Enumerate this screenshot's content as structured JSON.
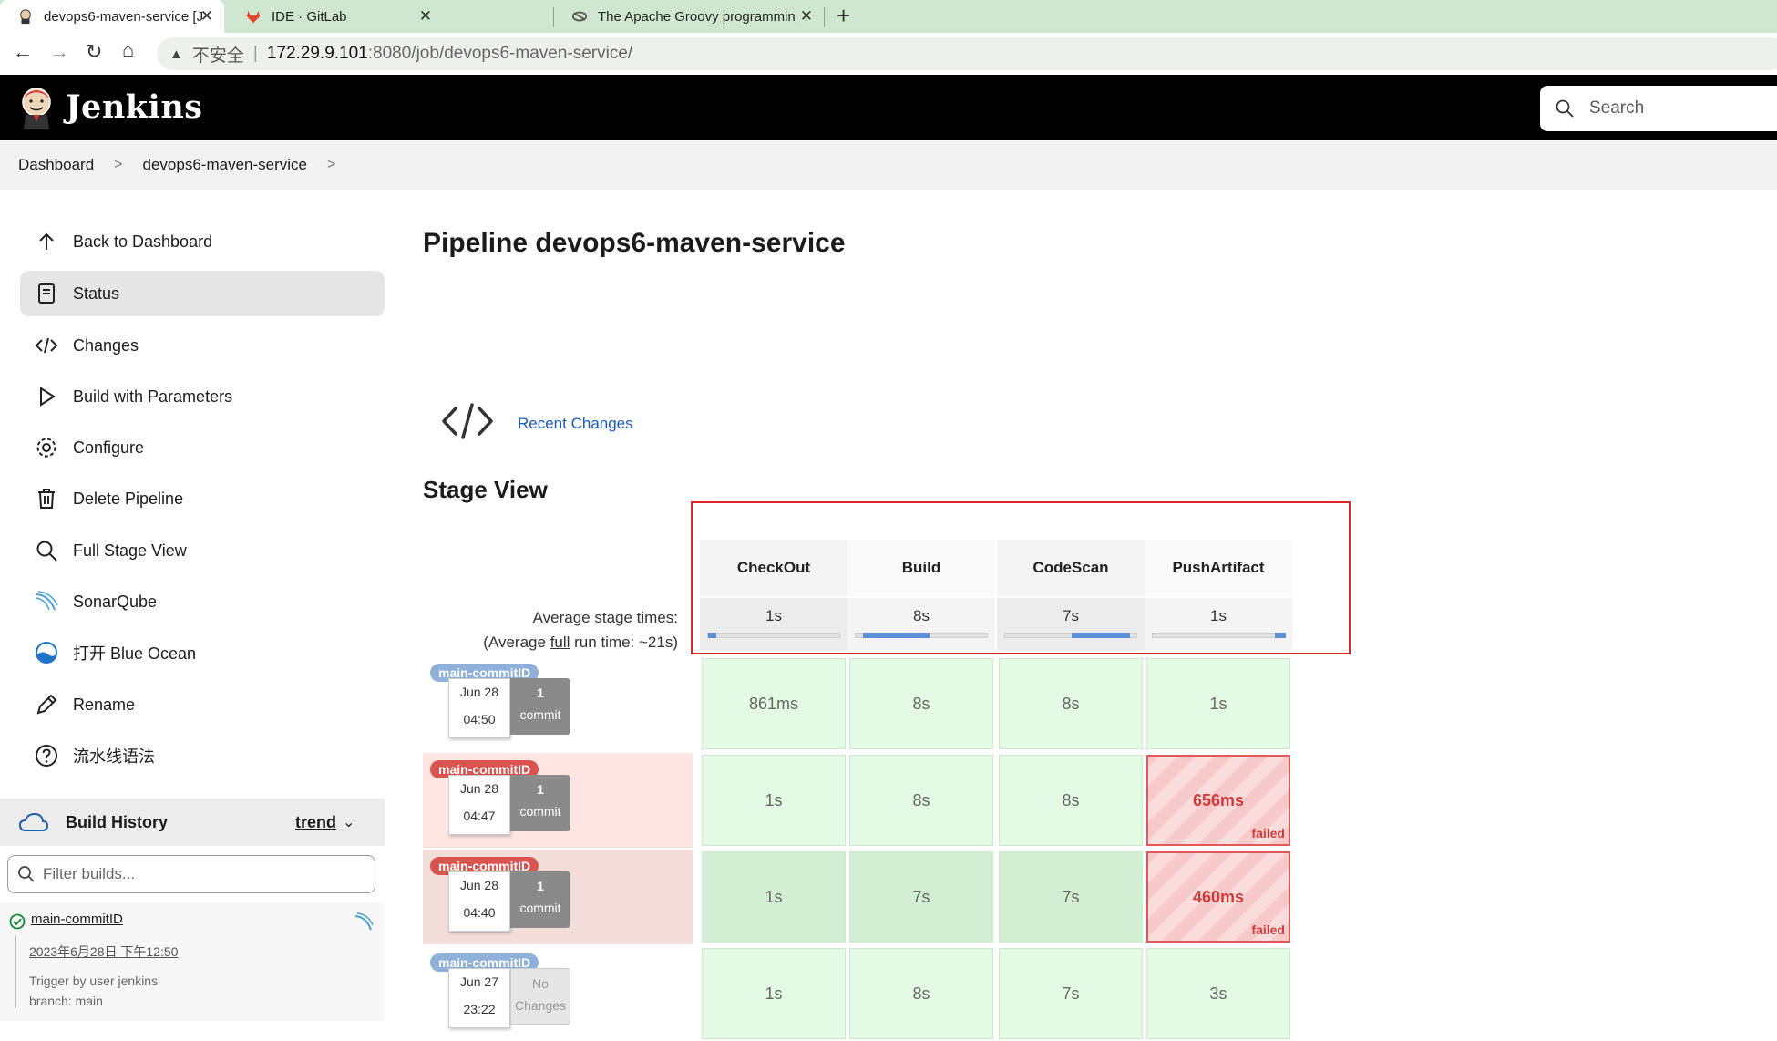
{
  "browser": {
    "tabs": [
      {
        "title": "devops6-maven-service [Jenkins]",
        "active": true,
        "icon": "jenkins-favicon"
      },
      {
        "title": "IDE · GitLab",
        "active": false,
        "icon": "gitlab-favicon"
      },
      {
        "title": "The Apache Groovy programming",
        "active": false,
        "icon": "groovy-favicon"
      }
    ],
    "address": {
      "insecure_label": "不安全",
      "host": "172.29.9.101",
      "path": ":8080/job/devops6-maven-service/"
    }
  },
  "header": {
    "brand": "Jenkins",
    "search_placeholder": "Search"
  },
  "breadcrumb": [
    "Dashboard",
    "devops6-maven-service"
  ],
  "sidebar": {
    "items": [
      {
        "label": "Back to Dashboard",
        "icon": "arrow-up-icon"
      },
      {
        "label": "Status",
        "icon": "document-icon",
        "active": true
      },
      {
        "label": "Changes",
        "icon": "code-icon"
      },
      {
        "label": "Build with Parameters",
        "icon": "play-icon"
      },
      {
        "label": "Configure",
        "icon": "gear-icon"
      },
      {
        "label": "Delete Pipeline",
        "icon": "trash-icon"
      },
      {
        "label": "Full Stage View",
        "icon": "search-icon"
      },
      {
        "label": "SonarQube",
        "icon": "sonarqube-icon"
      },
      {
        "label": "打开 Blue Ocean",
        "icon": "blue-ocean-icon"
      },
      {
        "label": "Rename",
        "icon": "pencil-icon"
      },
      {
        "label": "流水线语法",
        "icon": "help-circle-icon"
      }
    ]
  },
  "build_history": {
    "title": "Build History",
    "trend_label": "trend",
    "filter_placeholder": "Filter builds...",
    "entry": {
      "name": "main-commitID",
      "date": "2023年6月28日 下午12:50",
      "trigger": "Trigger by user jenkins",
      "branch": "branch: main"
    }
  },
  "main": {
    "title": "Pipeline devops6-maven-service",
    "recent_changes": "Recent Changes",
    "stage_view_title": "Stage View",
    "avg_label_1": "Average stage times:",
    "avg_label_2a": "(Average ",
    "avg_label_full": "full",
    "avg_label_2b": " run time: ~21s)"
  },
  "stages": [
    {
      "name": "CheckOut",
      "avg": "1s",
      "avg_fraction": 0.06
    },
    {
      "name": "Build",
      "avg": "8s",
      "avg_fraction": 0.5
    },
    {
      "name": "CodeScan",
      "avg": "7s",
      "avg_fraction": 0.44
    },
    {
      "name": "PushArtifact",
      "avg": "1s",
      "avg_fraction": 0.08
    }
  ],
  "runs": [
    {
      "badge": "main-commitID",
      "badge_status": "success",
      "date": "Jun 28",
      "time": "04:50",
      "commit_1": "1",
      "commit_2": "commit",
      "cells": [
        {
          "value": "861ms"
        },
        {
          "value": "8s"
        },
        {
          "value": "8s"
        },
        {
          "value": "1s"
        }
      ]
    },
    {
      "badge": "main-commitID",
      "badge_status": "failed",
      "date": "Jun 28",
      "time": "04:47",
      "commit_1": "1",
      "commit_2": "commit",
      "cells": [
        {
          "value": "1s"
        },
        {
          "value": "8s"
        },
        {
          "value": "8s"
        },
        {
          "value": "656ms",
          "failed": true,
          "failed_label": "failed"
        }
      ]
    },
    {
      "badge": "main-commitID",
      "badge_status": "failed",
      "date": "Jun 28",
      "time": "04:40",
      "commit_1": "1",
      "commit_2": "commit",
      "cells": [
        {
          "value": "1s"
        },
        {
          "value": "7s"
        },
        {
          "value": "7s"
        },
        {
          "value": "460ms",
          "failed": true,
          "failed_label": "failed"
        }
      ]
    },
    {
      "badge": "main-commitID",
      "badge_status": "success",
      "date": "Jun 27",
      "time": "23:22",
      "commit_1": "No",
      "commit_2": "Changes",
      "cells": [
        {
          "value": "1s"
        },
        {
          "value": "8s"
        },
        {
          "value": "7s"
        },
        {
          "value": "3s"
        }
      ]
    }
  ],
  "colors": {
    "badge_success": "#8fb0d8",
    "badge_failed": "#d9534f",
    "row_success_bg": "#ffffff",
    "row_failed_bg_1": "#fde6e1",
    "row_failed_bg_2": "#f2ddd8",
    "cell_success": "#e3fbe3",
    "cell_success_dark": "#d3efd3",
    "commit_box": "#8a8a8a",
    "commit_box_none": "#e6e6e6",
    "highlight_box": "#d9262b"
  }
}
